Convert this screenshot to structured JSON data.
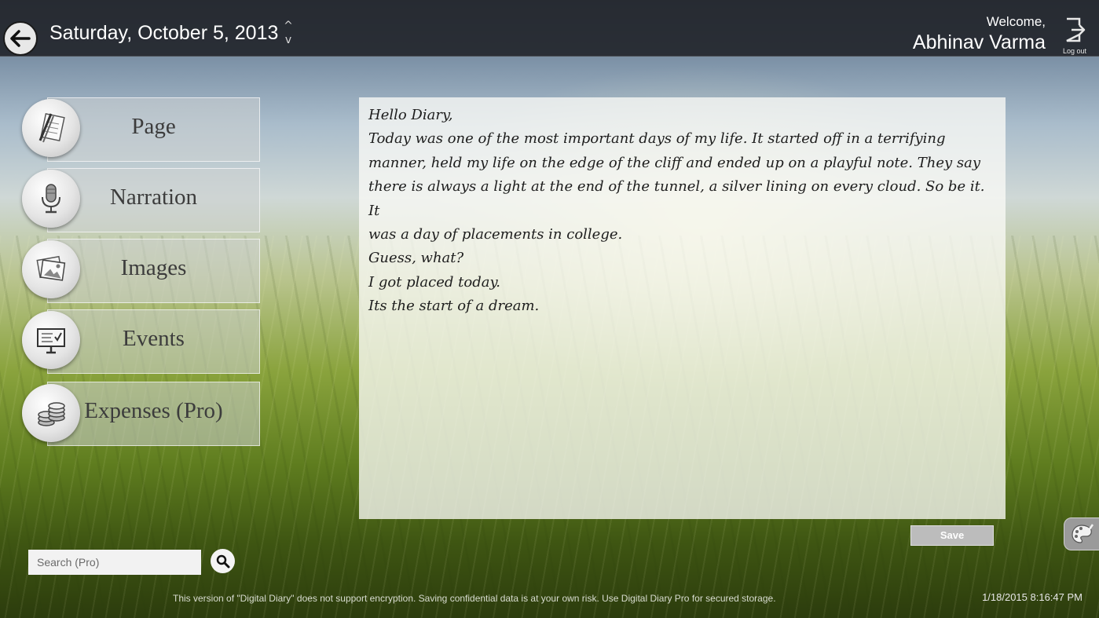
{
  "header": {
    "date": "Saturday, October 5, 2013",
    "prev_arrow": "^",
    "next_arrow": "v",
    "welcome": "Welcome,",
    "user_name": "Abhinav Varma",
    "logout_label": "Log out"
  },
  "menu": {
    "items": [
      {
        "label": "Page",
        "icon": "pen-paper-icon"
      },
      {
        "label": "Narration",
        "icon": "microphone-icon"
      },
      {
        "label": "Images",
        "icon": "photos-icon"
      },
      {
        "label": "Events",
        "icon": "presentation-board-icon"
      },
      {
        "label": "Expenses (Pro)",
        "icon": "coins-icon"
      }
    ]
  },
  "diary": {
    "text": "Hello Diary,\nToday was one of the most important days of my life. It started off in a terrifying\nmanner, held my life on the edge of the cliff and ended up on a playful note. They say\nthere is always a light at the end of the tunnel, a silver lining on every cloud. So be it. It\nwas a day of placements in college.\nGuess, what?\nI got placed today.\nIts the start of a dream."
  },
  "actions": {
    "save_label": "Save"
  },
  "search": {
    "placeholder": "Search (Pro)"
  },
  "footer": {
    "notice": "This version of \"Digital Diary\" does not support encryption. Saving confidential data is at your own risk. Use Digital Diary Pro for secured storage.",
    "timestamp": "1/18/2015 8:16:47 PM"
  }
}
